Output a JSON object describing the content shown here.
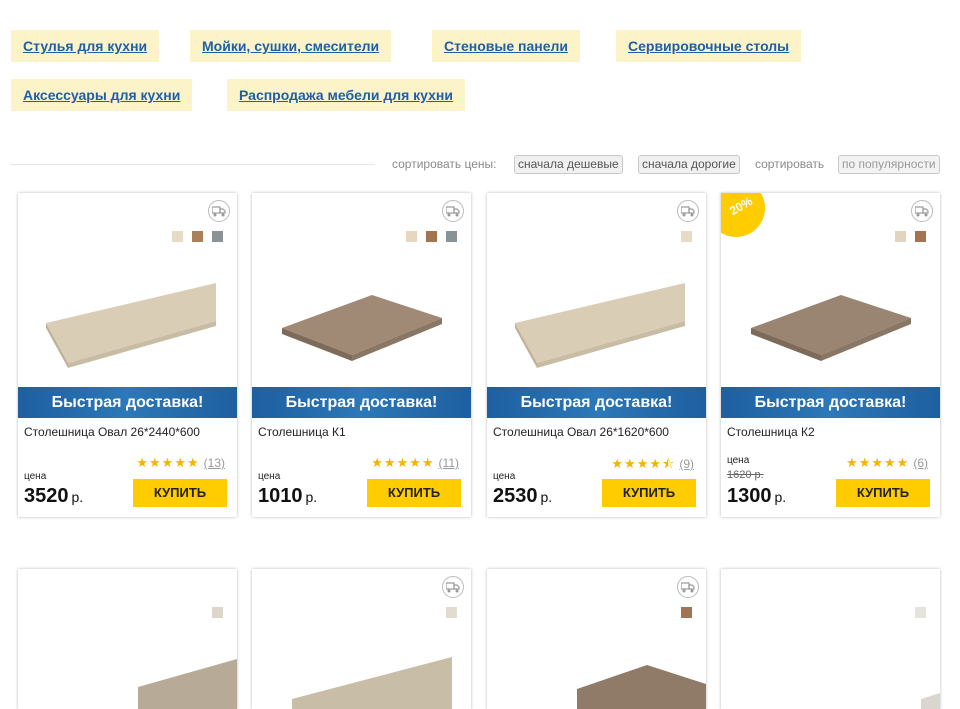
{
  "categories": [
    {
      "label": "Стулья для кухни"
    },
    {
      "label": "Мойки, сушки, смесители"
    },
    {
      "label": "Стеновые панели"
    },
    {
      "label": "Сервировочные столы"
    },
    {
      "label": "Аксессуары для кухни"
    },
    {
      "label": "Распродажа мебели для кухни"
    }
  ],
  "sort": {
    "price_label": "сортировать цены:",
    "cheap_first": "сначала дешевые",
    "expensive_first": "сначала дорогие",
    "sort_label": "сортировать",
    "popularity": "по популярности"
  },
  "delivery_label": "Быстрая доставка!",
  "buy_label": "КУПИТЬ",
  "price_label": "цена",
  "currency": "р.",
  "products": [
    {
      "name": "Столешница Овал 26*2440*600",
      "rating": 5,
      "reviews": "(13)",
      "price": "3520",
      "old_price": null,
      "discount": null,
      "swatches": [
        "#e6dcc6",
        "#a9805a",
        "#8b9296"
      ],
      "texture": "#d9ceb5"
    },
    {
      "name": "Столешница К1",
      "rating": 5,
      "reviews": "(11)",
      "price": "1010",
      "old_price": null,
      "discount": null,
      "swatches": [
        "#e6d7bf",
        "#a27452",
        "#8b9296"
      ],
      "texture": "#a08a76"
    },
    {
      "name": "Столешница Овал 26*1620*600",
      "rating": 4.5,
      "reviews": "(9)",
      "price": "2530",
      "old_price": null,
      "discount": null,
      "swatches": [
        "#e6dcc6"
      ],
      "texture": "#d9ceb5"
    },
    {
      "name": "Столешница К2",
      "rating": 5,
      "reviews": "(6)",
      "price": "1300",
      "old_price": "1620 р.",
      "discount": "20%",
      "swatches": [
        "#e3d5bd",
        "#a27452"
      ],
      "texture": "#9a8472"
    }
  ],
  "products_row2": [
    {
      "swatches": [
        "#ddd6ca"
      ],
      "texture": "#b7ab98"
    },
    {
      "swatches": [
        "#e2dccf"
      ],
      "texture": "#c8bda7"
    },
    {
      "swatches": [
        "#a27452"
      ],
      "texture": "#8f7b68"
    },
    {
      "swatches": [
        "#e4e3dc"
      ],
      "texture": "#d8d6ce"
    }
  ],
  "colors": {
    "accent": "#ffcc00",
    "link": "#1f5fa8",
    "category_bg": "#fdf3c8",
    "delivery_bg": "#1e5fa0"
  }
}
